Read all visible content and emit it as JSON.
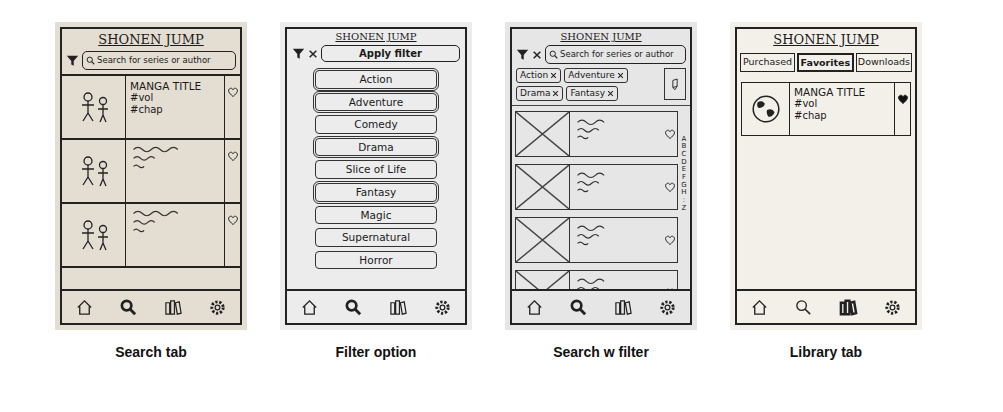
{
  "panels": [
    {
      "kind": "search",
      "caption": "Search tab",
      "title": "SHONEN JUMP",
      "search": {
        "placeholder": "Search for series or author"
      },
      "results": [
        {
          "kind": "text",
          "title": "MANGA TITLE",
          "vol": "#vol",
          "chap": "#chap",
          "favorite": false
        },
        {
          "kind": "scribble",
          "favorite": false
        },
        {
          "kind": "scribble",
          "favorite": false
        }
      ],
      "nav": [
        {
          "kind": "home",
          "selected": false
        },
        {
          "kind": "search",
          "selected": true
        },
        {
          "kind": "library",
          "selected": false
        },
        {
          "kind": "settings",
          "selected": false
        }
      ]
    },
    {
      "kind": "filter",
      "caption": "Filter option",
      "title": "SHONEN JUMP",
      "apply_button": "Apply filter",
      "genres": [
        {
          "label": "Action",
          "selected": true
        },
        {
          "label": "Adventure",
          "selected": true
        },
        {
          "label": "Comedy",
          "selected": false
        },
        {
          "label": "Drama",
          "selected": true
        },
        {
          "label": "Slice of Life",
          "selected": false
        },
        {
          "label": "Fantasy",
          "selected": true
        },
        {
          "label": "Magic",
          "selected": false
        },
        {
          "label": "Supernatural",
          "selected": false
        },
        {
          "label": "Horror",
          "selected": false
        }
      ],
      "nav": [
        {
          "kind": "home",
          "selected": false
        },
        {
          "kind": "search",
          "selected": true
        },
        {
          "kind": "library",
          "selected": false
        },
        {
          "kind": "settings",
          "selected": false
        }
      ]
    },
    {
      "kind": "filtered",
      "caption": "Search w filter",
      "title": "SHONEN JUMP",
      "search": {
        "placeholder": "Search for series or author"
      },
      "chips": [
        "Action",
        "Adventure",
        "Drama",
        "Fantasy"
      ],
      "results": [
        {
          "kind": "scribble",
          "favorite": false
        },
        {
          "kind": "scribble",
          "favorite": false
        },
        {
          "kind": "scribble",
          "favorite": false
        },
        {
          "kind": "scribble",
          "favorite": false
        },
        {
          "kind": "scribble",
          "favorite": false
        }
      ],
      "index": [
        "A",
        "B",
        "C",
        "D",
        "E",
        "F",
        "G",
        "H",
        ":",
        "Z"
      ],
      "nav": [
        {
          "kind": "home",
          "selected": false
        },
        {
          "kind": "search",
          "selected": true
        },
        {
          "kind": "library",
          "selected": false
        },
        {
          "kind": "settings",
          "selected": false
        }
      ]
    },
    {
      "kind": "library",
      "caption": "Library tab",
      "title": "SHONEN JUMP",
      "tabs": [
        {
          "label": "Purchased",
          "selected": false
        },
        {
          "label": "Favorites",
          "selected": true
        },
        {
          "label": "Downloads",
          "selected": false
        }
      ],
      "items": [
        {
          "title": "MANGA TITLE",
          "vol": "#vol",
          "chap": "#chap",
          "favorite": true
        }
      ],
      "nav": [
        {
          "kind": "home",
          "selected": false
        },
        {
          "kind": "search",
          "selected": false
        },
        {
          "kind": "library",
          "selected": true
        },
        {
          "kind": "settings",
          "selected": false
        }
      ]
    }
  ]
}
